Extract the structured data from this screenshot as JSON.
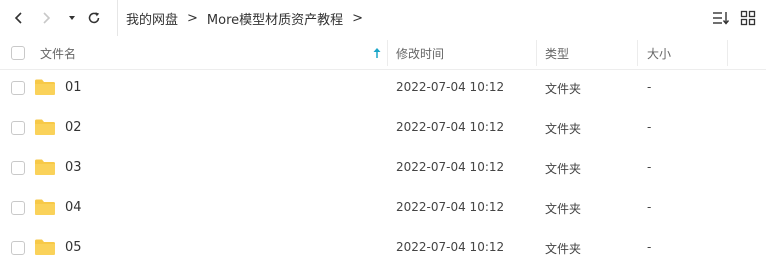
{
  "breadcrumb": {
    "root": "我的网盘",
    "current": "More模型材质资产教程",
    "sep": ">"
  },
  "columns": {
    "name": "文件名",
    "modified": "修改时间",
    "type": "类型",
    "size": "大小"
  },
  "rows": [
    {
      "name": "01",
      "modified": "2022-07-04 10:12",
      "type": "文件夹",
      "size": "-"
    },
    {
      "name": "02",
      "modified": "2022-07-04 10:12",
      "type": "文件夹",
      "size": "-"
    },
    {
      "name": "03",
      "modified": "2022-07-04 10:12",
      "type": "文件夹",
      "size": "-"
    },
    {
      "name": "04",
      "modified": "2022-07-04 10:12",
      "type": "文件夹",
      "size": "-"
    },
    {
      "name": "05",
      "modified": "2022-07-04 10:12",
      "type": "文件夹",
      "size": "-"
    }
  ],
  "icons": {
    "back": "chevron-left-icon",
    "forward": "chevron-right-icon",
    "history": "caret-down-icon",
    "refresh": "refresh-icon",
    "sort": "sort-icon",
    "grid": "grid-view-icon",
    "folder": "folder-icon",
    "sort_asc": "arrow-up-icon"
  },
  "colors": {
    "folder": "#F7C948",
    "sort_arrow": "#1aa6c8",
    "nav_disabled": "#c8c8c8"
  }
}
